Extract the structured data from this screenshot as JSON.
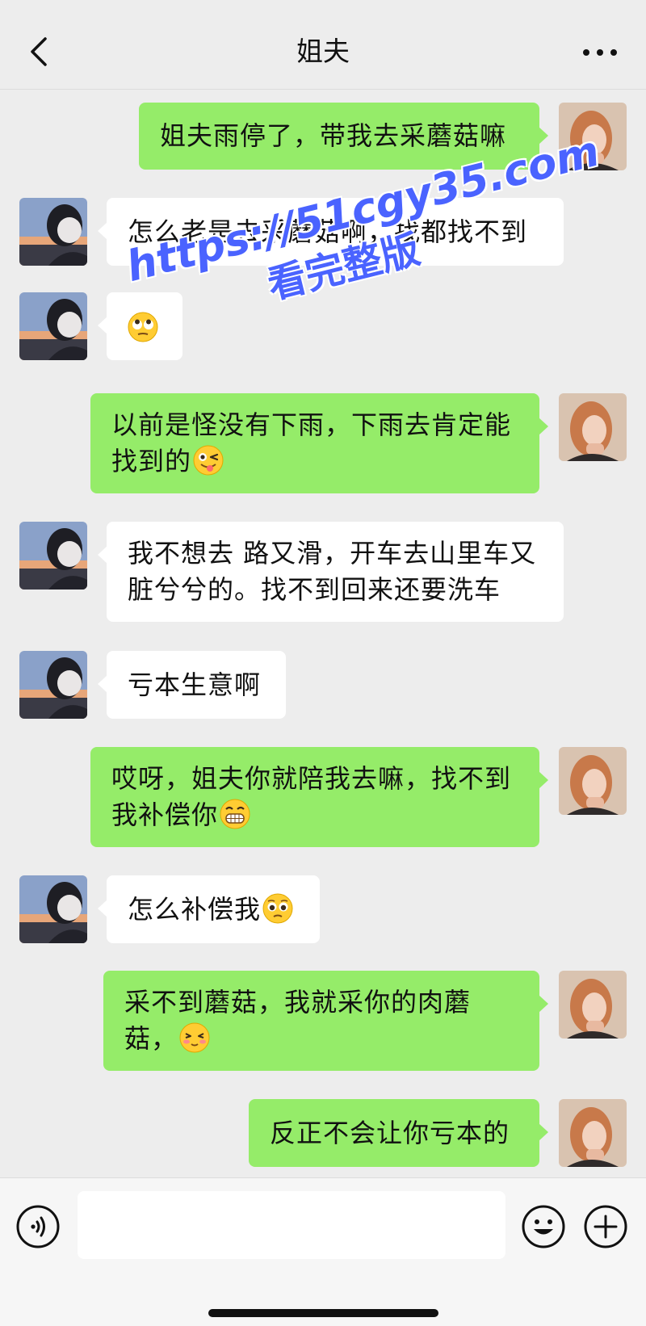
{
  "header": {
    "title": "姐夫"
  },
  "messages": [
    {
      "side": "me",
      "text": "姐夫雨停了，带我去采蘑菇嘛"
    },
    {
      "side": "other",
      "text": "怎么老是去采蘑菇啊，找都找不到"
    },
    {
      "side": "other",
      "emoji": "rolling-eyes-emoji"
    },
    {
      "side": "me",
      "text": "以前是怪没有下雨，下雨去肯定能找到的",
      "emoji": "wink-tongue-emoji"
    },
    {
      "side": "other",
      "text": "我不想去 路又滑，开车去山里车又脏兮兮的。找不到回来还要洗车"
    },
    {
      "side": "other",
      "text": "亏本生意啊"
    },
    {
      "side": "me",
      "text": "哎呀，姐夫你就陪我去嘛，找不到我补偿你",
      "emoji": "grin-emoji"
    },
    {
      "side": "other",
      "text": "怎么补偿我",
      "emoji": "pleading-emoji"
    },
    {
      "side": "me",
      "text": "采不到蘑菇，我就采你的肉蘑菇，",
      "emoji": "shy-blush-emoji"
    },
    {
      "side": "me",
      "text": "反正不会让你亏本的"
    }
  ],
  "watermark": {
    "line1": "https://51cgy35.com",
    "line2": "看完整版"
  },
  "colors": {
    "bubble_me": "#95ec69",
    "bubble_other": "#ffffff",
    "background": "#ededed",
    "watermark": "#4a63ff"
  },
  "icons": {
    "back": "chevron-left-icon",
    "more": "more-dots-icon",
    "voice": "voice-icon",
    "emoji": "emoji-face-icon",
    "plus": "plus-icon"
  }
}
